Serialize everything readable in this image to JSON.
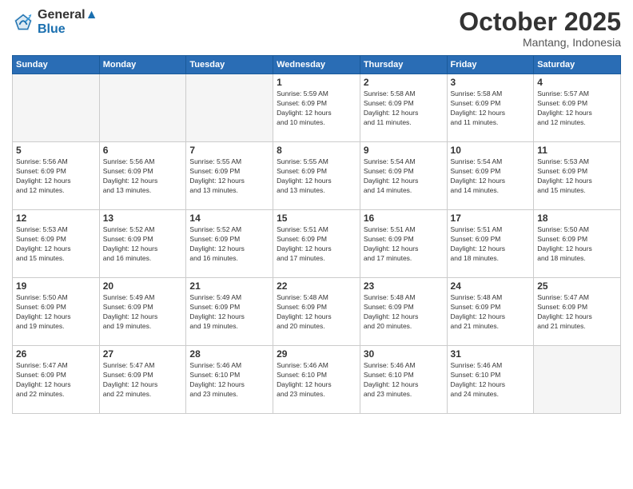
{
  "header": {
    "logo_line1": "General",
    "logo_line2": "Blue",
    "month": "October 2025",
    "location": "Mantang, Indonesia"
  },
  "weekdays": [
    "Sunday",
    "Monday",
    "Tuesday",
    "Wednesday",
    "Thursday",
    "Friday",
    "Saturday"
  ],
  "weeks": [
    [
      {
        "day": "",
        "info": ""
      },
      {
        "day": "",
        "info": ""
      },
      {
        "day": "",
        "info": ""
      },
      {
        "day": "1",
        "info": "Sunrise: 5:59 AM\nSunset: 6:09 PM\nDaylight: 12 hours\nand 10 minutes."
      },
      {
        "day": "2",
        "info": "Sunrise: 5:58 AM\nSunset: 6:09 PM\nDaylight: 12 hours\nand 11 minutes."
      },
      {
        "day": "3",
        "info": "Sunrise: 5:58 AM\nSunset: 6:09 PM\nDaylight: 12 hours\nand 11 minutes."
      },
      {
        "day": "4",
        "info": "Sunrise: 5:57 AM\nSunset: 6:09 PM\nDaylight: 12 hours\nand 12 minutes."
      }
    ],
    [
      {
        "day": "5",
        "info": "Sunrise: 5:56 AM\nSunset: 6:09 PM\nDaylight: 12 hours\nand 12 minutes."
      },
      {
        "day": "6",
        "info": "Sunrise: 5:56 AM\nSunset: 6:09 PM\nDaylight: 12 hours\nand 13 minutes."
      },
      {
        "day": "7",
        "info": "Sunrise: 5:55 AM\nSunset: 6:09 PM\nDaylight: 12 hours\nand 13 minutes."
      },
      {
        "day": "8",
        "info": "Sunrise: 5:55 AM\nSunset: 6:09 PM\nDaylight: 12 hours\nand 13 minutes."
      },
      {
        "day": "9",
        "info": "Sunrise: 5:54 AM\nSunset: 6:09 PM\nDaylight: 12 hours\nand 14 minutes."
      },
      {
        "day": "10",
        "info": "Sunrise: 5:54 AM\nSunset: 6:09 PM\nDaylight: 12 hours\nand 14 minutes."
      },
      {
        "day": "11",
        "info": "Sunrise: 5:53 AM\nSunset: 6:09 PM\nDaylight: 12 hours\nand 15 minutes."
      }
    ],
    [
      {
        "day": "12",
        "info": "Sunrise: 5:53 AM\nSunset: 6:09 PM\nDaylight: 12 hours\nand 15 minutes."
      },
      {
        "day": "13",
        "info": "Sunrise: 5:52 AM\nSunset: 6:09 PM\nDaylight: 12 hours\nand 16 minutes."
      },
      {
        "day": "14",
        "info": "Sunrise: 5:52 AM\nSunset: 6:09 PM\nDaylight: 12 hours\nand 16 minutes."
      },
      {
        "day": "15",
        "info": "Sunrise: 5:51 AM\nSunset: 6:09 PM\nDaylight: 12 hours\nand 17 minutes."
      },
      {
        "day": "16",
        "info": "Sunrise: 5:51 AM\nSunset: 6:09 PM\nDaylight: 12 hours\nand 17 minutes."
      },
      {
        "day": "17",
        "info": "Sunrise: 5:51 AM\nSunset: 6:09 PM\nDaylight: 12 hours\nand 18 minutes."
      },
      {
        "day": "18",
        "info": "Sunrise: 5:50 AM\nSunset: 6:09 PM\nDaylight: 12 hours\nand 18 minutes."
      }
    ],
    [
      {
        "day": "19",
        "info": "Sunrise: 5:50 AM\nSunset: 6:09 PM\nDaylight: 12 hours\nand 19 minutes."
      },
      {
        "day": "20",
        "info": "Sunrise: 5:49 AM\nSunset: 6:09 PM\nDaylight: 12 hours\nand 19 minutes."
      },
      {
        "day": "21",
        "info": "Sunrise: 5:49 AM\nSunset: 6:09 PM\nDaylight: 12 hours\nand 19 minutes."
      },
      {
        "day": "22",
        "info": "Sunrise: 5:48 AM\nSunset: 6:09 PM\nDaylight: 12 hours\nand 20 minutes."
      },
      {
        "day": "23",
        "info": "Sunrise: 5:48 AM\nSunset: 6:09 PM\nDaylight: 12 hours\nand 20 minutes."
      },
      {
        "day": "24",
        "info": "Sunrise: 5:48 AM\nSunset: 6:09 PM\nDaylight: 12 hours\nand 21 minutes."
      },
      {
        "day": "25",
        "info": "Sunrise: 5:47 AM\nSunset: 6:09 PM\nDaylight: 12 hours\nand 21 minutes."
      }
    ],
    [
      {
        "day": "26",
        "info": "Sunrise: 5:47 AM\nSunset: 6:09 PM\nDaylight: 12 hours\nand 22 minutes."
      },
      {
        "day": "27",
        "info": "Sunrise: 5:47 AM\nSunset: 6:09 PM\nDaylight: 12 hours\nand 22 minutes."
      },
      {
        "day": "28",
        "info": "Sunrise: 5:46 AM\nSunset: 6:10 PM\nDaylight: 12 hours\nand 23 minutes."
      },
      {
        "day": "29",
        "info": "Sunrise: 5:46 AM\nSunset: 6:10 PM\nDaylight: 12 hours\nand 23 minutes."
      },
      {
        "day": "30",
        "info": "Sunrise: 5:46 AM\nSunset: 6:10 PM\nDaylight: 12 hours\nand 23 minutes."
      },
      {
        "day": "31",
        "info": "Sunrise: 5:46 AM\nSunset: 6:10 PM\nDaylight: 12 hours\nand 24 minutes."
      },
      {
        "day": "",
        "info": ""
      }
    ]
  ]
}
